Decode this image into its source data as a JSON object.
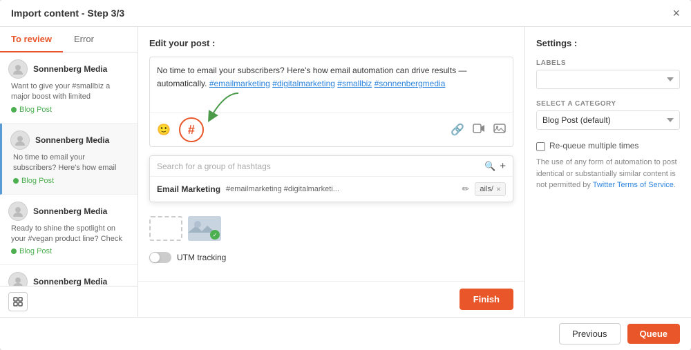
{
  "modal": {
    "title": "Import content - Step 3/3",
    "close_label": "×"
  },
  "tabs": [
    {
      "id": "to-review",
      "label": "To review",
      "active": true
    },
    {
      "id": "error",
      "label": "Error",
      "active": false
    }
  ],
  "sidebar_items": [
    {
      "name": "Sonnenberg Media",
      "desc": "Want to give your #smallbiz a major boost with limited",
      "tag": "Blog Post"
    },
    {
      "name": "Sonnenberg Media",
      "desc": "No time to email your subscribers? Here's how email",
      "tag": "Blog Post",
      "selected": true
    },
    {
      "name": "Sonnenberg Media",
      "desc": "Ready to shine the spotlight on your #vegan product line? Check",
      "tag": "Blog Post"
    },
    {
      "name": "Sonnenberg Media",
      "desc": "",
      "tag": ""
    }
  ],
  "main": {
    "section_label": "Edit your post :",
    "post_text": "No time to email your subscribers? Here's how email automation can drive results — automatically. #emailmarketing #digitalmarketing #smallbiz #sonnenbergmedia",
    "hashtag_search_placeholder": "Search for a group of hashtags",
    "hashtag_group_name": "Email Marketing",
    "hashtag_group_tags": "#emailmarketing #digitalmarketi...",
    "detail_text": "ails/",
    "utm_label": "UTM tracking",
    "finish_label": "Finish"
  },
  "settings": {
    "title": "Settings :",
    "labels_label": "LABELS",
    "labels_placeholder": "",
    "category_label": "SELECT A CATEGORY",
    "category_value": "Blog Post  (default)",
    "requeue_label": "Re-queue multiple times",
    "tos_text": "The use of any form of automation to post identical or substantially similar content is not permitted by ",
    "tos_link_text": "Twitter Terms of Service",
    "tos_end": "."
  },
  "footer": {
    "previous_label": "Previous",
    "queue_label": "Queue"
  },
  "icons": {
    "emoji": "🙂",
    "link": "🔗",
    "video": "📷",
    "image": "🖼",
    "hashtag": "#",
    "search": "🔍",
    "add": "+",
    "edit": "✏",
    "close": "×",
    "check": "✓"
  }
}
